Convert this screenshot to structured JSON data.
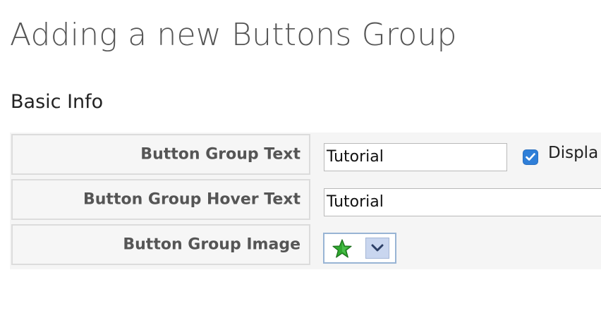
{
  "page_title": "Adding a new Buttons Group",
  "section_title": "Basic Info",
  "form": {
    "rows": [
      {
        "label": "Button Group Text",
        "value": "Tutorial",
        "checkbox_label": "Displa",
        "checkbox_checked": true
      },
      {
        "label": "Button Group Hover Text",
        "value": "Tutorial"
      },
      {
        "label": "Button Group Image",
        "selected_icon": "green-star-icon"
      }
    ]
  },
  "colors": {
    "checkbox": "#2f7fd8",
    "star_fill": "#2fa82f",
    "dropdown_bg": "#c9d6ef",
    "picker_border": "#98b4d4"
  }
}
